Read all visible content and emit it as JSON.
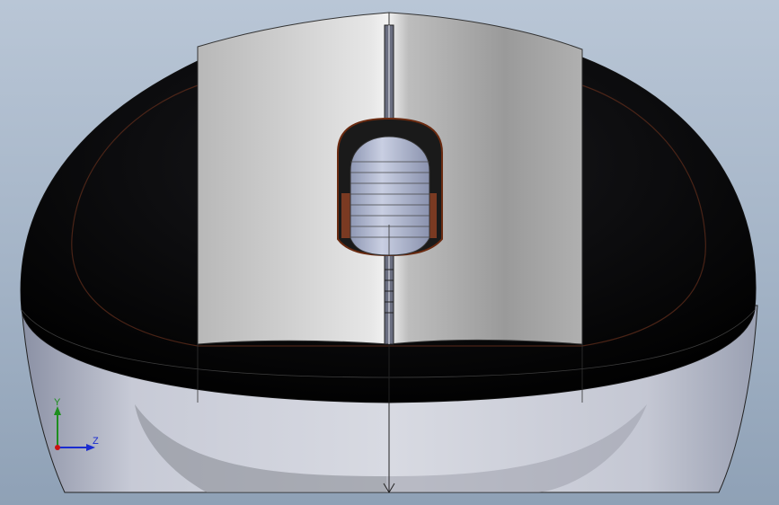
{
  "view": {
    "background_top": "#b9c6d6",
    "background_bottom": "#8fa1b6"
  },
  "model": {
    "shell_color": "#0a0a0c",
    "body_color": "#c9ccd6",
    "button_color": "#b5b5b5",
    "cut_edge_color": "#7a2a10"
  },
  "triad": {
    "y_label": "Y",
    "z_label": "Z",
    "y_color": "#1e8e1e",
    "z_color": "#1a2cd0",
    "origin_color": "#cc1111"
  }
}
